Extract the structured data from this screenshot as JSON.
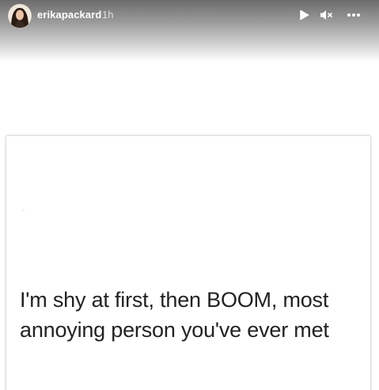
{
  "story": {
    "username": "erikapackard",
    "timestamp": "1h",
    "controls": {
      "play_icon": "play-icon",
      "mute_icon": "speaker-muted-icon",
      "more_icon": "more-horizontal-icon"
    },
    "post": {
      "line1": "I'm shy at first, then BOOM, most",
      "line2": "annoying person you've ever met"
    }
  },
  "colors": {
    "header_dark": "#6b6b6b",
    "background": "#ffffff",
    "text": "#222222",
    "header_text": "#ffffff"
  }
}
